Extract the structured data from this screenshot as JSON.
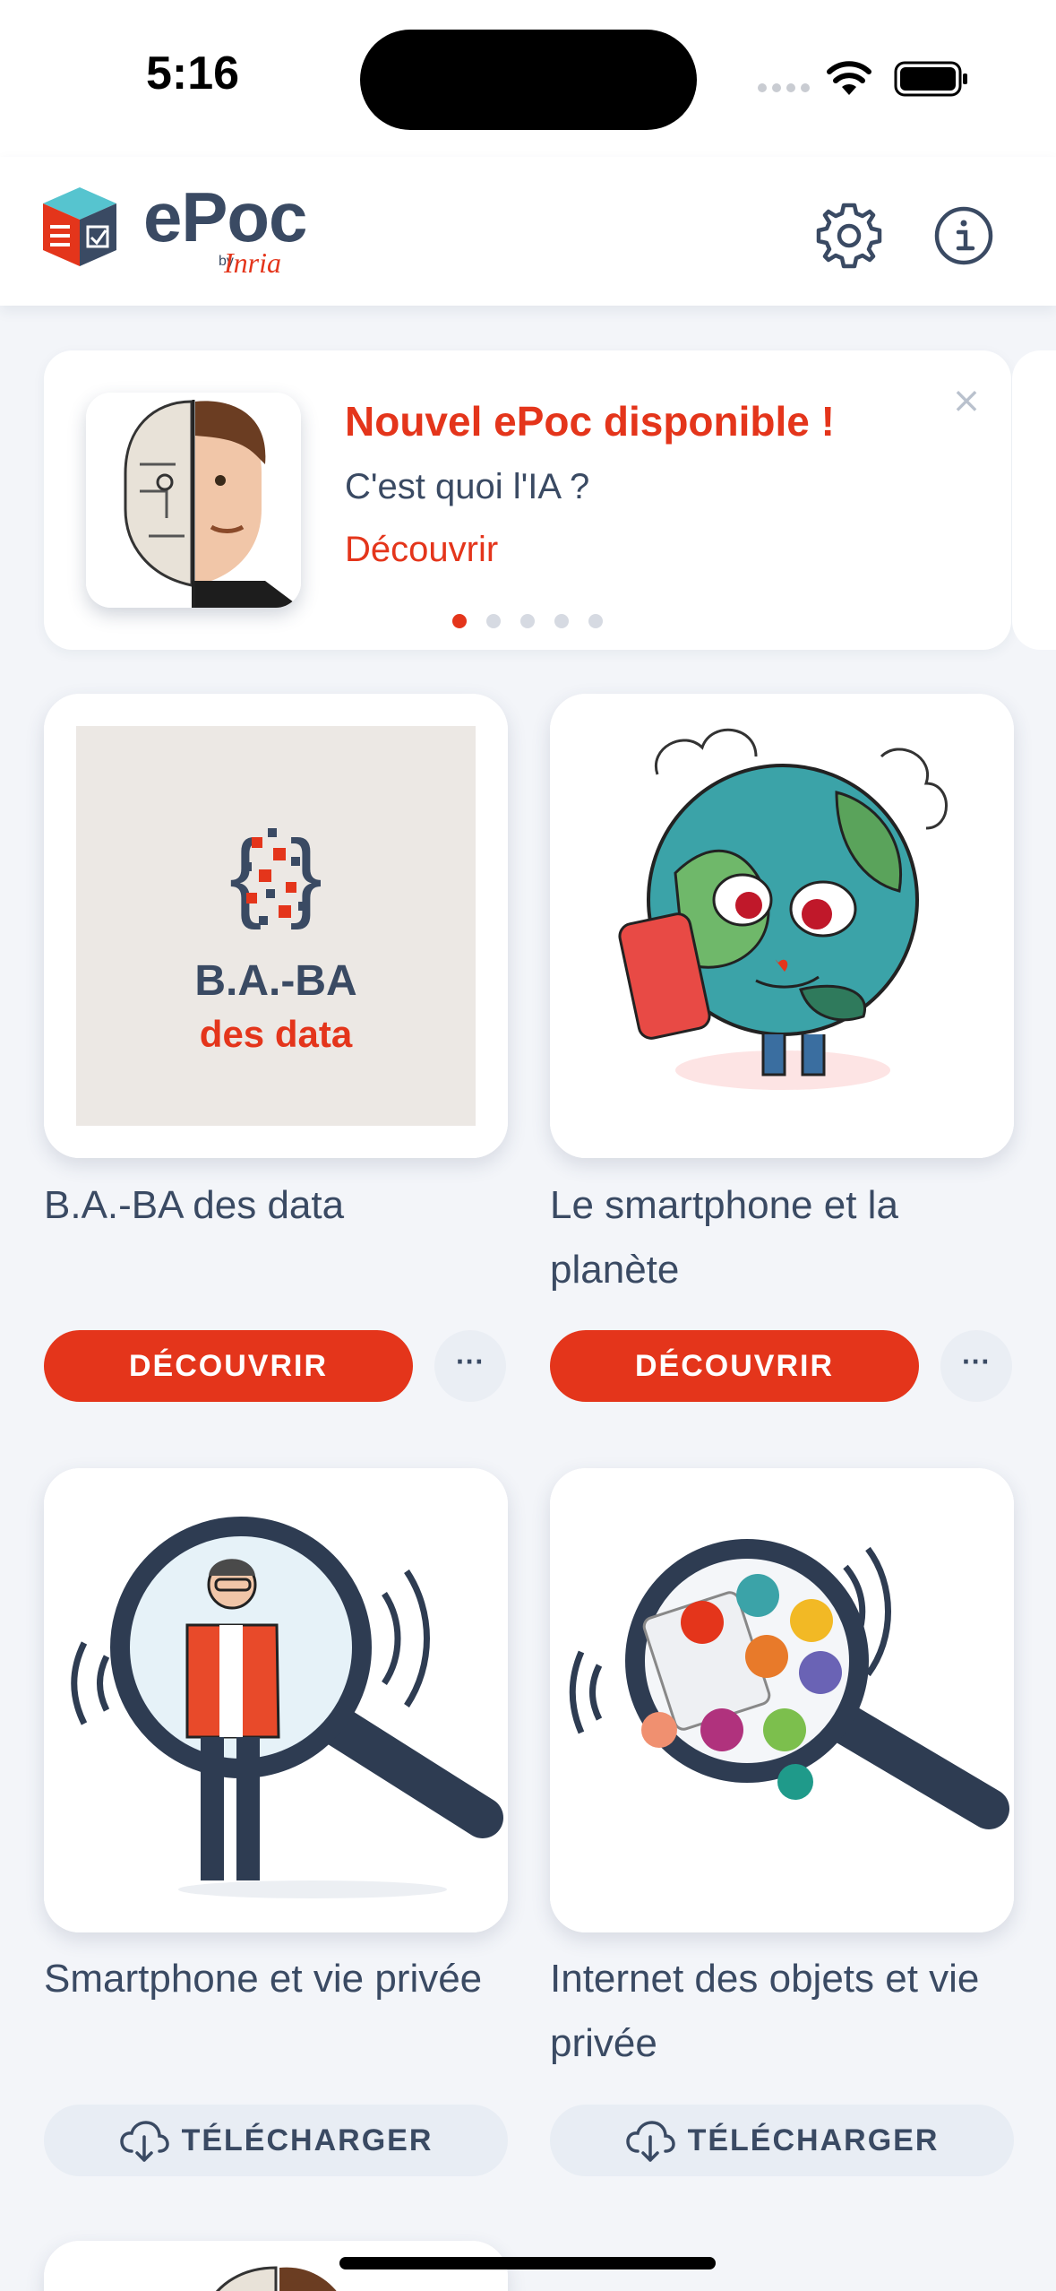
{
  "status_bar": {
    "time": "5:16"
  },
  "header": {
    "logo_text": "ePoc",
    "logo_by": "by",
    "logo_brand": "Inria",
    "settings_icon": "gear-icon",
    "info_icon": "info-icon"
  },
  "banner": {
    "title": "Nouvel ePoc disponible !",
    "subtitle": "C'est quoi l'IA ?",
    "link": "Découvrir",
    "close_icon": "close-icon",
    "page_count": 5,
    "active_page": 1
  },
  "courses": [
    {
      "title": "B.A.-BA des data",
      "image_text_line1": "B.A.-BA",
      "image_text_line2": "des data",
      "action": "DÉCOUVRIR",
      "more": "···"
    },
    {
      "title": "Le smartphone et la planète",
      "action": "DÉCOUVRIR",
      "more": "···"
    },
    {
      "title": "Smartphone et vie privée",
      "action": "TÉLÉCHARGER"
    },
    {
      "title": "Internet des objets et vie privée",
      "action": "TÉLÉCHARGER"
    }
  ],
  "colors": {
    "accent": "#e4351b",
    "text": "#3a4a63",
    "background": "#f3f5f9"
  }
}
